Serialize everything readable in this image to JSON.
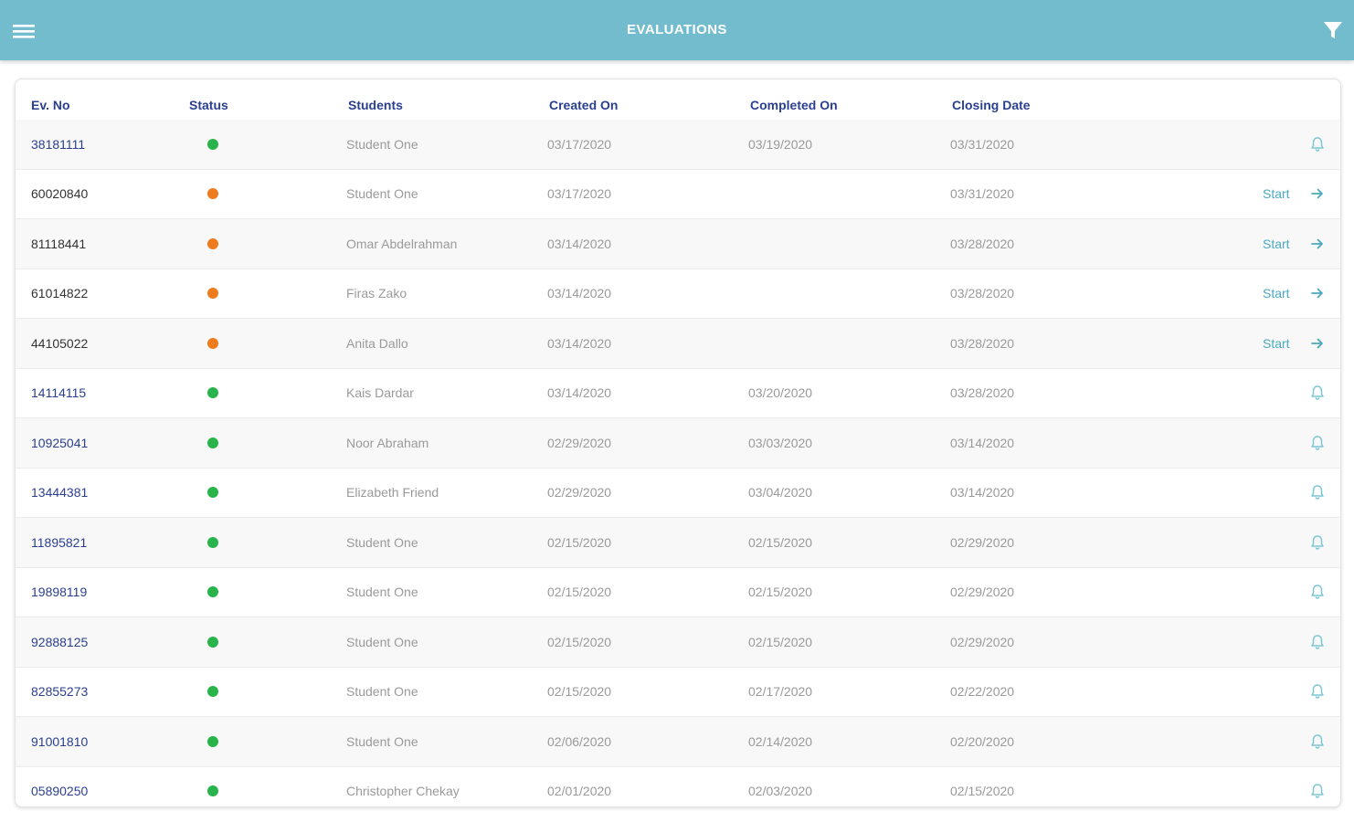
{
  "app_bar": {
    "title": "EVALUATIONS",
    "menu_icon": "hamburger-menu-icon",
    "filter_icon": "filter-icon",
    "color": "#72bccd"
  },
  "table": {
    "headers": {
      "no": "Ev. No",
      "status": "Status",
      "students": "Students",
      "created": "Created On",
      "completed": "Completed On",
      "closing": "Closing Date"
    },
    "status_colors": {
      "completed": "#28b34b",
      "pending": "#ee7b1e"
    },
    "start_label": "Start",
    "rows": [
      {
        "no": "38181111",
        "status": "completed",
        "student": "Student One",
        "created": "03/17/2020",
        "completed": "03/19/2020",
        "closing": "03/31/2020",
        "action": "bell"
      },
      {
        "no": "60020840",
        "status": "pending",
        "student": "Student One",
        "created": "03/17/2020",
        "completed": "",
        "closing": "03/31/2020",
        "action": "start"
      },
      {
        "no": "81118441",
        "status": "pending",
        "student": "Omar Abdelrahman",
        "created": "03/14/2020",
        "completed": "",
        "closing": "03/28/2020",
        "action": "start"
      },
      {
        "no": "61014822",
        "status": "pending",
        "student": "Firas Zako",
        "created": "03/14/2020",
        "completed": "",
        "closing": "03/28/2020",
        "action": "start"
      },
      {
        "no": "44105022",
        "status": "pending",
        "student": "Anita Dallo",
        "created": "03/14/2020",
        "completed": "",
        "closing": "03/28/2020",
        "action": "start"
      },
      {
        "no": "14114115",
        "status": "completed",
        "student": "Kais Dardar",
        "created": "03/14/2020",
        "completed": "03/20/2020",
        "closing": "03/28/2020",
        "action": "bell"
      },
      {
        "no": "10925041",
        "status": "completed",
        "student": "Noor Abraham",
        "created": "02/29/2020",
        "completed": "03/03/2020",
        "closing": "03/14/2020",
        "action": "bell"
      },
      {
        "no": "13444381",
        "status": "completed",
        "student": "Elizabeth Friend",
        "created": "02/29/2020",
        "completed": "03/04/2020",
        "closing": "03/14/2020",
        "action": "bell"
      },
      {
        "no": "11895821",
        "status": "completed",
        "student": "Student One",
        "created": "02/15/2020",
        "completed": "02/15/2020",
        "closing": "02/29/2020",
        "action": "bell"
      },
      {
        "no": "19898119",
        "status": "completed",
        "student": "Student One",
        "created": "02/15/2020",
        "completed": "02/15/2020",
        "closing": "02/29/2020",
        "action": "bell"
      },
      {
        "no": "92888125",
        "status": "completed",
        "student": "Student One",
        "created": "02/15/2020",
        "completed": "02/15/2020",
        "closing": "02/29/2020",
        "action": "bell"
      },
      {
        "no": "82855273",
        "status": "completed",
        "student": "Student One",
        "created": "02/15/2020",
        "completed": "02/17/2020",
        "closing": "02/22/2020",
        "action": "bell"
      },
      {
        "no": "91001810",
        "status": "completed",
        "student": "Student One",
        "created": "02/06/2020",
        "completed": "02/14/2020",
        "closing": "02/20/2020",
        "action": "bell"
      },
      {
        "no": "05890250",
        "status": "completed",
        "student": "Christopher Chekay",
        "created": "02/01/2020",
        "completed": "02/03/2020",
        "closing": "02/15/2020",
        "action": "bell"
      }
    ]
  }
}
